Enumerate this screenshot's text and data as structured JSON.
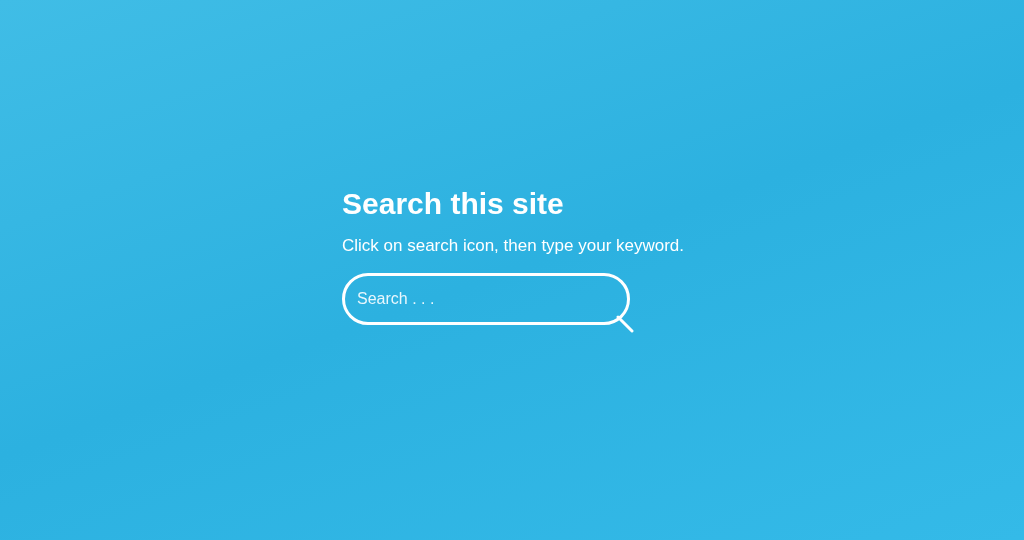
{
  "heading": "Search this site",
  "subtitle": "Click on search icon, then type your keyword.",
  "search": {
    "placeholder": "Search . . ."
  }
}
